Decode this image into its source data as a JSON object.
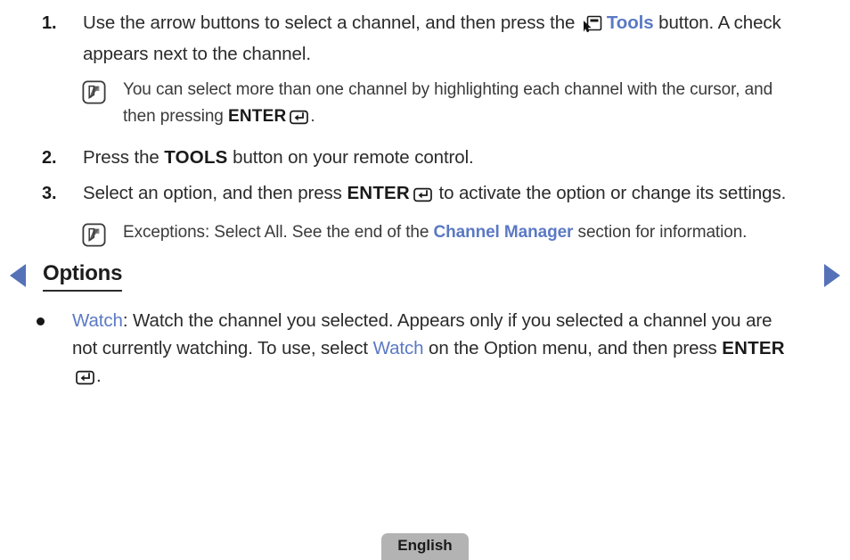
{
  "document": {
    "type": "e-manual-page",
    "background_color": "#ffffff",
    "text_color": "#2b2b2b",
    "link_color": "#5b79c4",
    "arrow_color": "#5572b8"
  },
  "navigation": {
    "prev_label": "Previous page",
    "next_label": "Next page",
    "prev_icon": "triangle-left-icon",
    "next_icon": "triangle-right-icon"
  },
  "steps": [
    {
      "number": "1.",
      "parts": [
        {
          "type": "text",
          "value": "Use the arrow buttons to select a channel, and then press the "
        },
        {
          "type": "icon",
          "value": "tools-icon"
        },
        {
          "type": "link",
          "value": "Tools"
        },
        {
          "type": "text",
          "value": " button. A check appears next to the channel."
        }
      ],
      "note": {
        "icon": "note-icon",
        "parts": [
          {
            "type": "text",
            "value": "You can select more than one channel by highlighting each channel with the cursor, and then pressing "
          },
          {
            "type": "kbd",
            "value": "ENTER"
          },
          {
            "type": "icon",
            "value": "enter-icon"
          },
          {
            "type": "text",
            "value": "."
          }
        ]
      }
    },
    {
      "number": "2.",
      "parts": [
        {
          "type": "text",
          "value": "Press the "
        },
        {
          "type": "kbd",
          "value": "TOOLS"
        },
        {
          "type": "text",
          "value": " button on your remote control."
        }
      ]
    },
    {
      "number": "3.",
      "parts": [
        {
          "type": "text",
          "value": "Select an option, and then press "
        },
        {
          "type": "kbd",
          "value": "ENTER"
        },
        {
          "type": "icon",
          "value": "enter-icon"
        },
        {
          "type": "text",
          "value": " to activate the option or change its settings."
        }
      ],
      "note": {
        "icon": "note-icon",
        "parts": [
          {
            "type": "text",
            "value": "Exceptions: Select All. See the end of the "
          },
          {
            "type": "link-strong",
            "value": "Channel Manager"
          },
          {
            "type": "text",
            "value": " section for information."
          }
        ]
      }
    }
  ],
  "step1": {
    "number": "1.",
    "text_a": "Use the arrow buttons to select a channel, and then press the",
    "tools_label": "Tools",
    "text_b": " button. A check appears next to the channel.",
    "note_text_a": "You can select more than one channel by highlighting each channel with the cursor, and then pressing ",
    "note_kbd": "ENTER",
    "note_text_b": "."
  },
  "step2": {
    "number": "2.",
    "text_a": "Press the ",
    "kbd": "TOOLS",
    "text_b": " button on your remote control."
  },
  "step3": {
    "number": "3.",
    "text_a": "Select an option, and then press ",
    "kbd": "ENTER",
    "text_b": " to activate the option or change its settings.",
    "note_text_a": "Exceptions: Select All. See the end of the ",
    "note_link": "Channel Manager",
    "note_text_b": " section for information."
  },
  "options": {
    "heading": "Options",
    "items": [
      {
        "link": "Watch",
        "text_a": ": Watch the channel you selected. Appears only if you selected a channel you are not currently watching. To use, select ",
        "link2": "Watch",
        "text_b": " on the Option menu, and then press ",
        "kbd": "ENTER",
        "text_c": "."
      }
    ]
  },
  "footer": {
    "language": "English",
    "badge_color": "#b3b3b3"
  }
}
